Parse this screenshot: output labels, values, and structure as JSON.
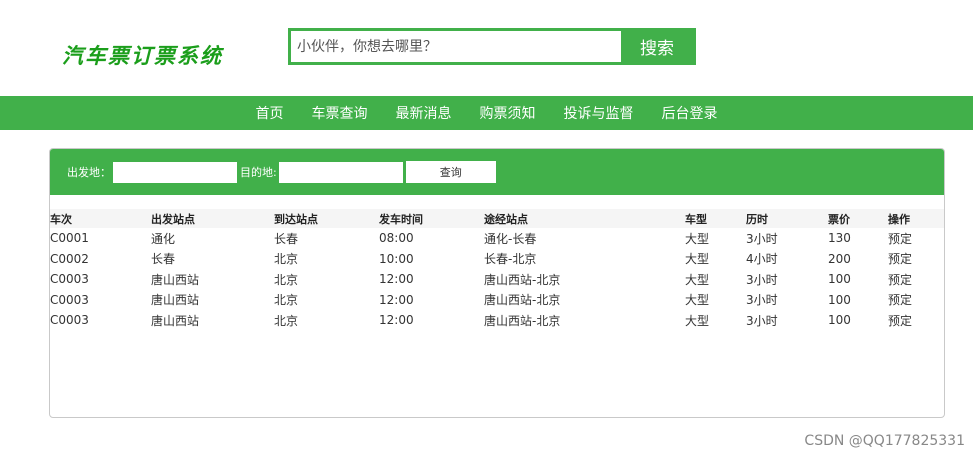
{
  "logo": "汽车票订票系统",
  "search": {
    "placeholder": "小伙伴，你想去哪里？",
    "button": "搜索"
  },
  "nav": [
    "首页",
    "车票查询",
    "最新消息",
    "购票须知",
    "投诉与监督",
    "后台登录"
  ],
  "filter": {
    "from_label": "出发地：",
    "to_label": "目的地:",
    "query_button": "查询"
  },
  "table": {
    "headers": [
      "车次",
      "出发站点",
      "到达站点",
      "发车时间",
      "途经站点",
      "车型",
      "历时",
      "票价",
      "操作"
    ],
    "rows": [
      [
        "C0001",
        "通化",
        "长春",
        "08:00",
        "通化-长春",
        "大型",
        "3小时",
        "130",
        "预定"
      ],
      [
        "C0002",
        "长春",
        "北京",
        "10:00",
        "长春-北京",
        "大型",
        "4小时",
        "200",
        "预定"
      ],
      [
        "C0003",
        "唐山西站",
        "北京",
        "12:00",
        "唐山西站-北京",
        "大型",
        "3小时",
        "100",
        "预定"
      ],
      [
        "C0003",
        "唐山西站",
        "北京",
        "12:00",
        "唐山西站-北京",
        "大型",
        "3小时",
        "100",
        "预定"
      ],
      [
        "C0003",
        "唐山西站",
        "北京",
        "12:00",
        "唐山西站-北京",
        "大型",
        "3小时",
        "100",
        "预定"
      ]
    ]
  },
  "watermark": "CSDN @QQ177825331",
  "colors": {
    "accent": "#41b04a",
    "logo": "#1b9e1b"
  }
}
